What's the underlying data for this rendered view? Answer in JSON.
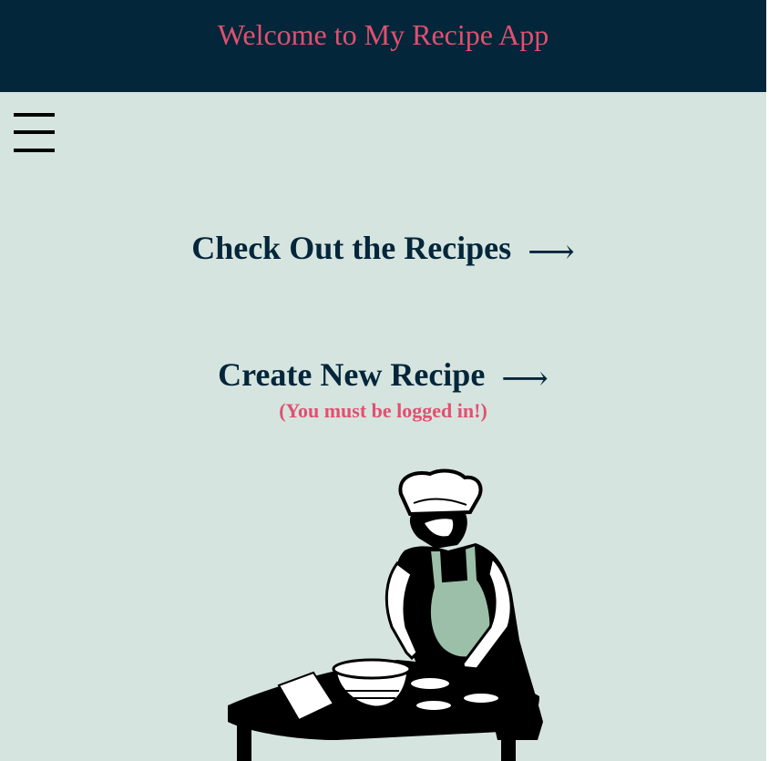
{
  "header": {
    "title": "Welcome to My Recipe App"
  },
  "menu": {
    "icon": "hamburger-menu-icon"
  },
  "main": {
    "recipes_link": {
      "label": "Check Out the Recipes",
      "arrow": "⟶"
    },
    "create_link": {
      "label": "Create New Recipe",
      "arrow": "⟶",
      "note": "(You must be logged in!)"
    }
  },
  "illustration": {
    "icon": "chef-baking-illustration"
  },
  "colors": {
    "header_bg": "#03263a",
    "page_bg": "#d6e4df",
    "accent": "#e0506f",
    "link": "#03263a",
    "apron": "#9bbfa8"
  }
}
